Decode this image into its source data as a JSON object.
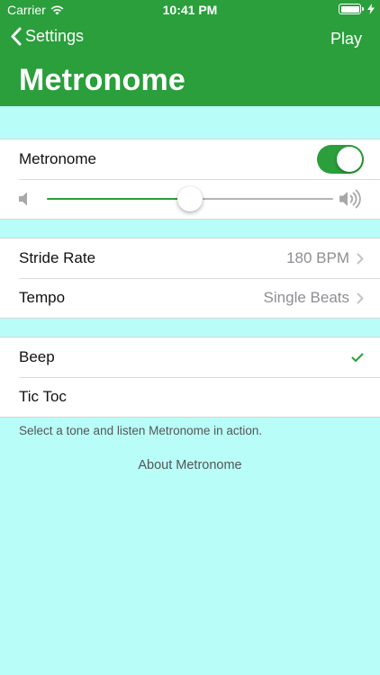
{
  "status_bar": {
    "carrier": "Carrier",
    "time": "10:41 PM"
  },
  "nav": {
    "back_label": "Settings",
    "play_label": "Play",
    "title": "Metronome"
  },
  "metronome_group": {
    "toggle_label": "Metronome",
    "toggle_on": true,
    "volume_level": 0.5
  },
  "settings_group": {
    "stride_rate_label": "Stride Rate",
    "stride_rate_value": "180 BPM",
    "tempo_label": "Tempo",
    "tempo_value": "Single Beats"
  },
  "tone_group": {
    "tones": [
      "Beep",
      "Tic Toc"
    ],
    "selected_tone": "Beep",
    "footer": "Select a tone and listen Metronome in action."
  },
  "about_link": "About Metronome",
  "colors": {
    "accent": "#2a9f3b",
    "background": "#b9fdf9"
  },
  "icons": [
    "wifi-icon",
    "battery-icon",
    "charging-bolt-icon",
    "back-chevron-icon",
    "volume-low-icon",
    "volume-high-icon",
    "disclosure-chevron-icon",
    "checkmark-icon"
  ]
}
